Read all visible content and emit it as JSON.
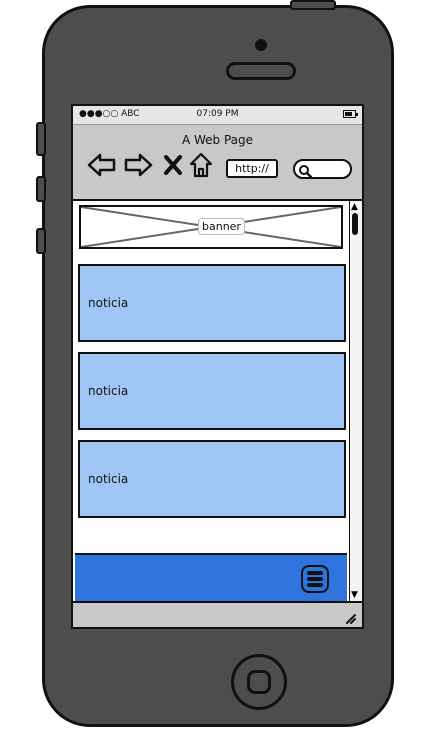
{
  "status_bar": {
    "carrier": "●●●○○ ABC",
    "time": "07:09 PM"
  },
  "browser": {
    "title": "A Web Page",
    "url": "http://"
  },
  "content": {
    "banner_label": "banner",
    "cards": [
      {
        "label": "noticia"
      },
      {
        "label": "noticia"
      },
      {
        "label": "noticia"
      }
    ]
  },
  "icons": {
    "back": "arrow-left-icon",
    "forward": "arrow-right-icon",
    "stop": "close-icon",
    "home": "home-icon",
    "search": "search-icon",
    "menu": "hamburger-icon"
  },
  "colors": {
    "phone_body": "#4d4d4d",
    "toolbar": "#c8c8c8",
    "card": "#a0c6f5",
    "bottom_bar": "#2f73dc"
  }
}
